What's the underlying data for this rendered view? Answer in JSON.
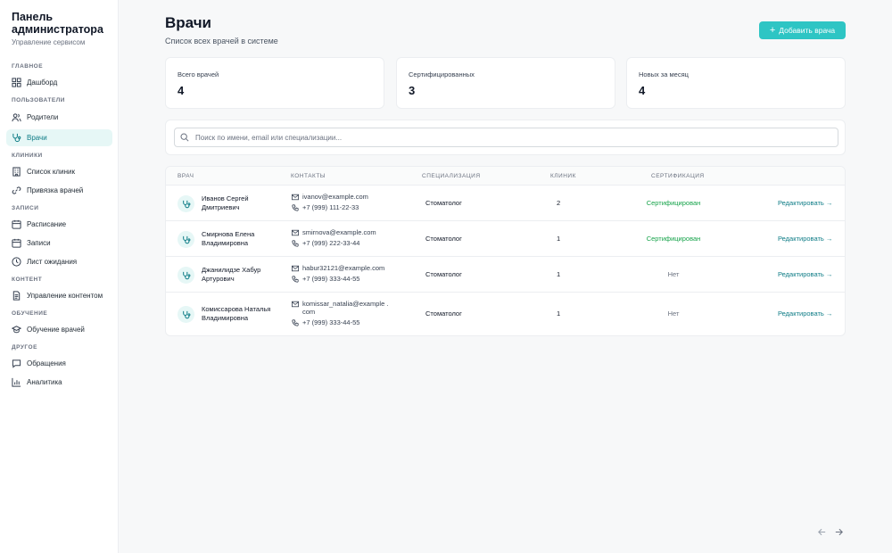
{
  "sidebar": {
    "title": "Панель администратора",
    "subtitle": "Управление сервисом",
    "sections": {
      "main": "ГЛАВНОЕ",
      "users": "ПОЛЬЗОВАТЕЛИ",
      "clinics": "КЛИНИКИ",
      "records": "ЗАПИСИ",
      "content": "КОНТЕНТ",
      "training": "ОБУЧЕНИЕ",
      "other": "ДРУГОЕ"
    },
    "items": {
      "dashboard": "Дашборд",
      "parents": "Родители",
      "doctors": "Врачи",
      "clinic_list": "Список клиник",
      "doctor_binding": "Привязка врачей",
      "schedule": "Расписание",
      "appointments": "Записи",
      "waitlist": "Лист ожидания",
      "content_mgmt": "Управление контентом",
      "doctor_training": "Обучение врачей",
      "requests": "Обращения",
      "analytics": "Аналитика"
    },
    "active_item": "doctors"
  },
  "header": {
    "title": "Врачи",
    "subtitle": "Список всех врачей в системе",
    "add_button": "Добавить врача"
  },
  "stats": [
    {
      "label": "Всего врачей",
      "value": "4"
    },
    {
      "label": "Сертифицированных",
      "value": "3"
    },
    {
      "label": "Новых за месяц",
      "value": "4"
    }
  ],
  "search": {
    "placeholder": "Поиск по имени, email или специализации..."
  },
  "table": {
    "columns": {
      "doctor": "ВРАЧ",
      "contacts": "КОНТАКТЫ",
      "specialization": "СПЕЦИАЛИЗАЦИЯ",
      "clinics": "КЛИНИК",
      "certification": "СЕРТИФИКАЦИЯ"
    },
    "rows": [
      {
        "name": "Иванов Сергей Дмитриевич",
        "email": "ivanov@example.com",
        "phone": "+7 (999) 111-22-33",
        "specialization": "Стоматолог",
        "clinics": "2",
        "certification": "Сертифицирован",
        "certified": true,
        "action": "Редактировать →"
      },
      {
        "name": "Смирнова Елена Владимировна",
        "email": "smirnova@example.com",
        "phone": "+7 (999) 222-33-44",
        "specialization": "Стоматолог",
        "clinics": "1",
        "certification": "Сертифицирован",
        "certified": true,
        "action": "Редактировать →"
      },
      {
        "name": "Джанилидзе Хабур Артурович",
        "email": "habur32121@example.com",
        "phone": "+7 (999) 333-44-55",
        "specialization": "Стоматолог",
        "clinics": "1",
        "certification": "Нет",
        "certified": false,
        "action": "Редактировать →"
      },
      {
        "name": "Комиссарова Наталья Владимировна",
        "email": "komissar_natalia@example .com",
        "phone": "+7 (999) 333-44-55",
        "specialization": "Стоматолог",
        "clinics": "1",
        "certification": "Нет",
        "certified": false,
        "action": "Редактировать →"
      }
    ]
  },
  "colors": {
    "accent": "#2ec5c4",
    "accent_dark": "#0e7c86",
    "active_bg": "#e6f7f6",
    "certified": "#16a34a",
    "muted": "#6b7280"
  },
  "icons": {
    "pager_prev": "arrow-left-icon",
    "pager_next": "arrow-right-icon"
  }
}
